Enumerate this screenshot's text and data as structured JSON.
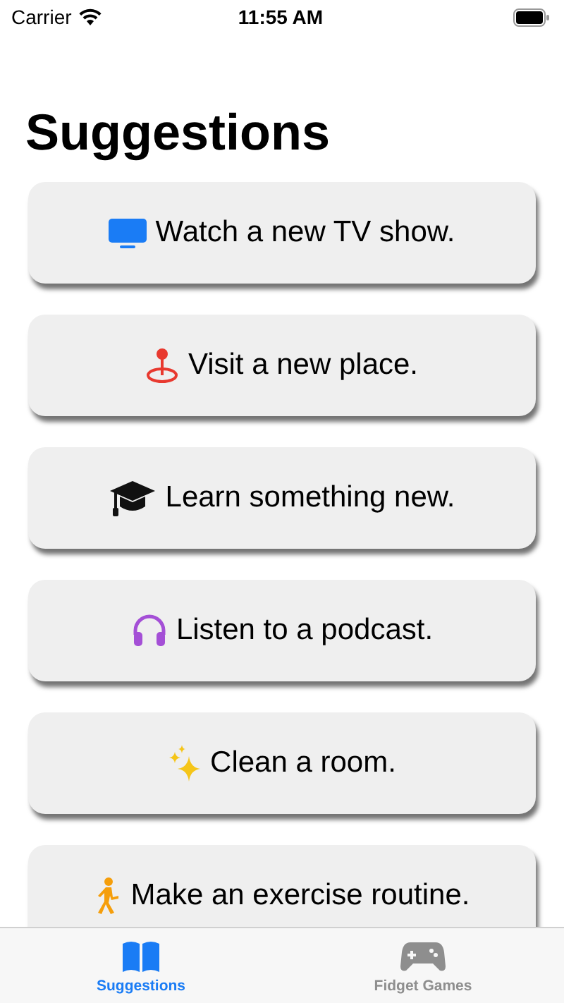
{
  "status_bar": {
    "carrier": "Carrier",
    "time": "11:55 AM"
  },
  "title": "Suggestions",
  "suggestions": [
    {
      "kind": "tv",
      "label": "Watch a new TV show."
    },
    {
      "kind": "pin",
      "label": "Visit a new place."
    },
    {
      "kind": "cap",
      "label": "Learn something new."
    },
    {
      "kind": "headphones",
      "label": "Listen to a podcast."
    },
    {
      "kind": "sparkles",
      "label": "Clean a room."
    },
    {
      "kind": "walk",
      "label": "Make an exercise routine."
    }
  ],
  "tabs": [
    {
      "kind": "book",
      "label": "Suggestions",
      "selected": true
    },
    {
      "kind": "gamepad",
      "label": "Fidget Games",
      "selected": false
    }
  ]
}
